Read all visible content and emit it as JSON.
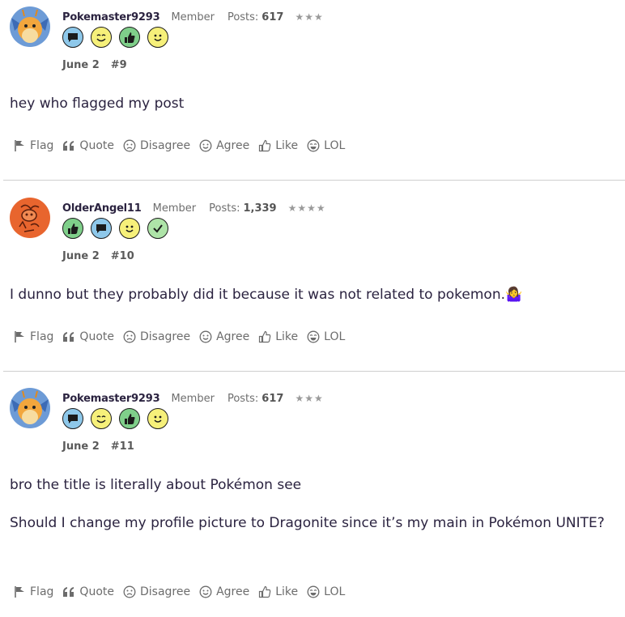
{
  "posts": [
    {
      "username": "Pokemaster9293",
      "role": "Member",
      "posts_label": "Posts:",
      "posts_count": "617",
      "stars": "★★★",
      "date": "June 2",
      "post_number": "#9",
      "avatar": "dragonite-avatar",
      "badges": [
        "speech-bubble-badge",
        "wink-badge",
        "thumbs-up-badge",
        "smile-badge"
      ],
      "body": [
        "hey who flagged my post"
      ]
    },
    {
      "username": "OlderAngel11",
      "role": "Member",
      "posts_label": "Posts:",
      "posts_count": "1,339",
      "stars": "★★★★",
      "date": "June 2",
      "post_number": "#10",
      "avatar": "sketch-avatar",
      "badges": [
        "thumbs-up-badge",
        "speech-bubble-badge",
        "smile-badge",
        "check-badge"
      ],
      "body": [
        "I dunno but they probably did it because it was not related to pokemon.🤷‍♀️"
      ]
    },
    {
      "username": "Pokemaster9293",
      "role": "Member",
      "posts_label": "Posts:",
      "posts_count": "617",
      "stars": "★★★",
      "date": "June 2",
      "post_number": "#11",
      "avatar": "dragonite-avatar",
      "badges": [
        "speech-bubble-badge",
        "wink-badge",
        "thumbs-up-badge",
        "smile-badge"
      ],
      "body": [
        "bro the title is literally about Pokémon see",
        "Should I change my profile picture to Dragonite since it’s my main in Pokémon UNITE?"
      ]
    }
  ],
  "actions": {
    "flag": "Flag",
    "quote": "Quote",
    "disagree": "Disagree",
    "agree": "Agree",
    "like": "Like",
    "lol": "LOL"
  },
  "colors": {
    "badge_blue": "#8ec8ea",
    "badge_yellow": "#f6f07a",
    "badge_green": "#7fcf8a",
    "text": "#2b2340",
    "muted": "#6c6c6c",
    "divider": "#cfcfcf"
  }
}
